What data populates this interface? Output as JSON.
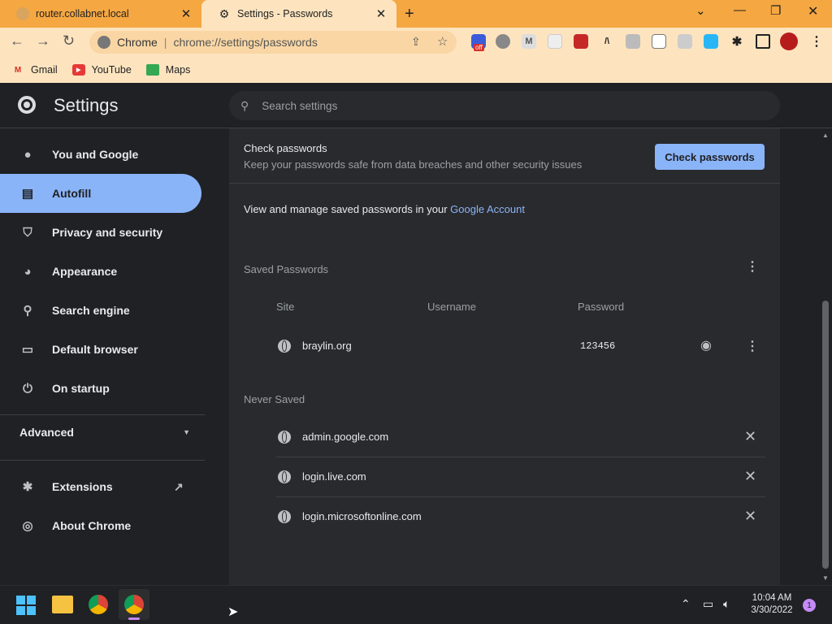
{
  "browser": {
    "tabs": [
      {
        "title": "router.collabnet.local",
        "active": false
      },
      {
        "title": "Settings - Passwords",
        "active": true
      }
    ],
    "omnibox": {
      "site_label": "Chrome",
      "url": "chrome://settings/passwords"
    },
    "bookmarks": [
      {
        "label": "Gmail",
        "icon": "gmail-icon"
      },
      {
        "label": "YouTube",
        "icon": "youtube-icon"
      },
      {
        "label": "Maps",
        "icon": "maps-icon"
      }
    ],
    "extension_badge": "off"
  },
  "settings": {
    "title": "Settings",
    "search_placeholder": "Search settings",
    "sidebar": [
      {
        "label": "You and Google",
        "icon": "person-icon"
      },
      {
        "label": "Autofill",
        "icon": "clipboard-icon",
        "selected": true
      },
      {
        "label": "Privacy and security",
        "icon": "shield-icon"
      },
      {
        "label": "Appearance",
        "icon": "palette-icon"
      },
      {
        "label": "Search engine",
        "icon": "search-icon"
      },
      {
        "label": "Default browser",
        "icon": "browser-icon"
      },
      {
        "label": "On startup",
        "icon": "power-icon"
      }
    ],
    "advanced_label": "Advanced",
    "extensions_label": "Extensions",
    "about_label": "About Chrome"
  },
  "passwords": {
    "check_title": "Check passwords",
    "check_desc": "Keep your passwords safe from data breaches and other security issues",
    "check_button": "Check passwords",
    "manage_text": "View and manage saved passwords in your",
    "manage_link": "Google Account",
    "saved_heading": "Saved Passwords",
    "columns": {
      "site": "Site",
      "username": "Username",
      "password": "Password"
    },
    "saved": [
      {
        "site": "braylin.org",
        "username": "",
        "password": "123456"
      }
    ],
    "never_heading": "Never Saved",
    "never_saved": [
      "admin.google.com",
      "login.live.com",
      "login.microsoftonline.com"
    ]
  },
  "taskbar": {
    "time": "10:04 AM",
    "date": "3/30/2022",
    "notification_count": "1"
  },
  "colors": {
    "accent": "#8ab4f8",
    "tab_strip": "#f5a742",
    "toolbar": "#fde4bf",
    "surface": "#292a2d",
    "background": "#202124"
  }
}
